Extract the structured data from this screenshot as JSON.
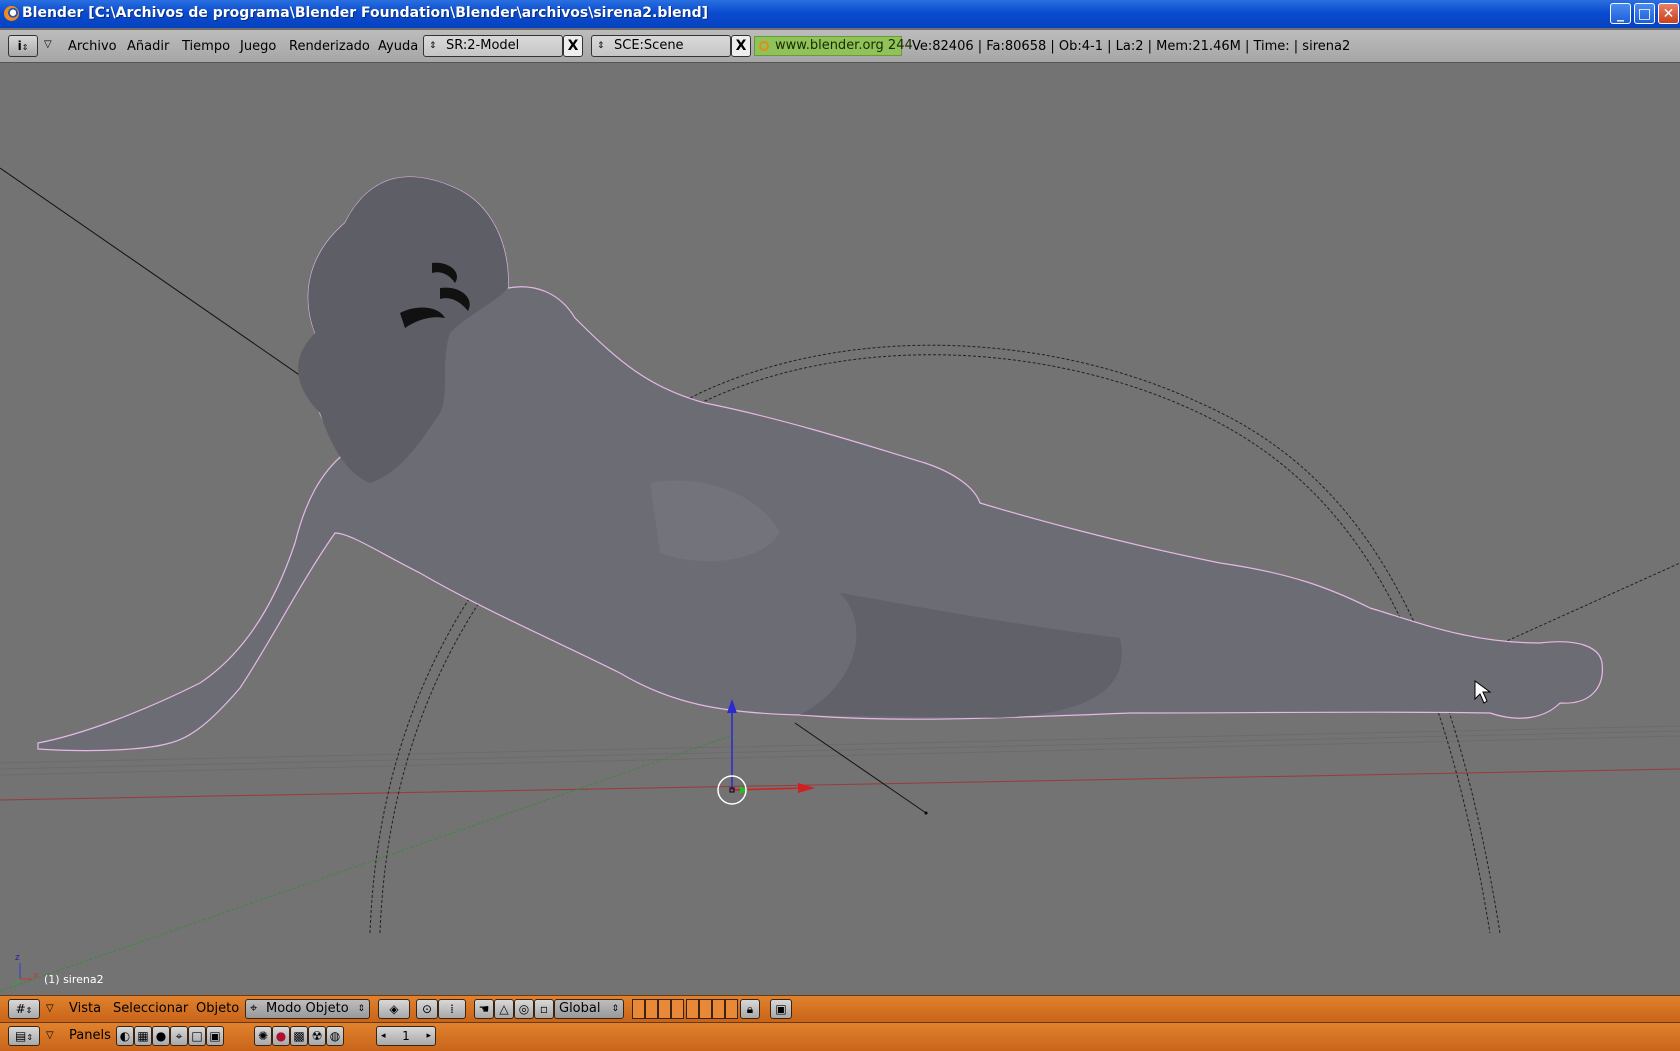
{
  "window": {
    "title": "Blender [C:\\Archivos de programa\\Blender Foundation\\Blender\\archivos\\sirena2.blend]",
    "minimize": "_",
    "maximize": "□",
    "close": "✕"
  },
  "header": {
    "menus": [
      "Archivo",
      "Añadir",
      "Tiempo",
      "Juego",
      "Renderizado",
      "Ayuda"
    ],
    "screen_field": "SR:2-Model",
    "scene_field": "SCE:Scene",
    "close_glyph": "X",
    "link": "www.blender.org 244",
    "stats": "Ve:82406 | Fa:80658 | Ob:4-1 | La:2  | Mem:21.46M  | Time: | sirena2"
  },
  "viewport": {
    "object_label": "(1) sirena2",
    "axis_z": "z",
    "axis_x": "x"
  },
  "view3d_header": {
    "menus": [
      "Vista",
      "Seleccionar",
      "Objeto"
    ],
    "mode": "Modo Objeto",
    "orientation": "Global"
  },
  "buttons_header": {
    "panels_label": "Panels",
    "frame": "1"
  },
  "colors": {
    "accent": "#d8741f",
    "viewport": "#737373",
    "link_green": "#8fc35a"
  }
}
